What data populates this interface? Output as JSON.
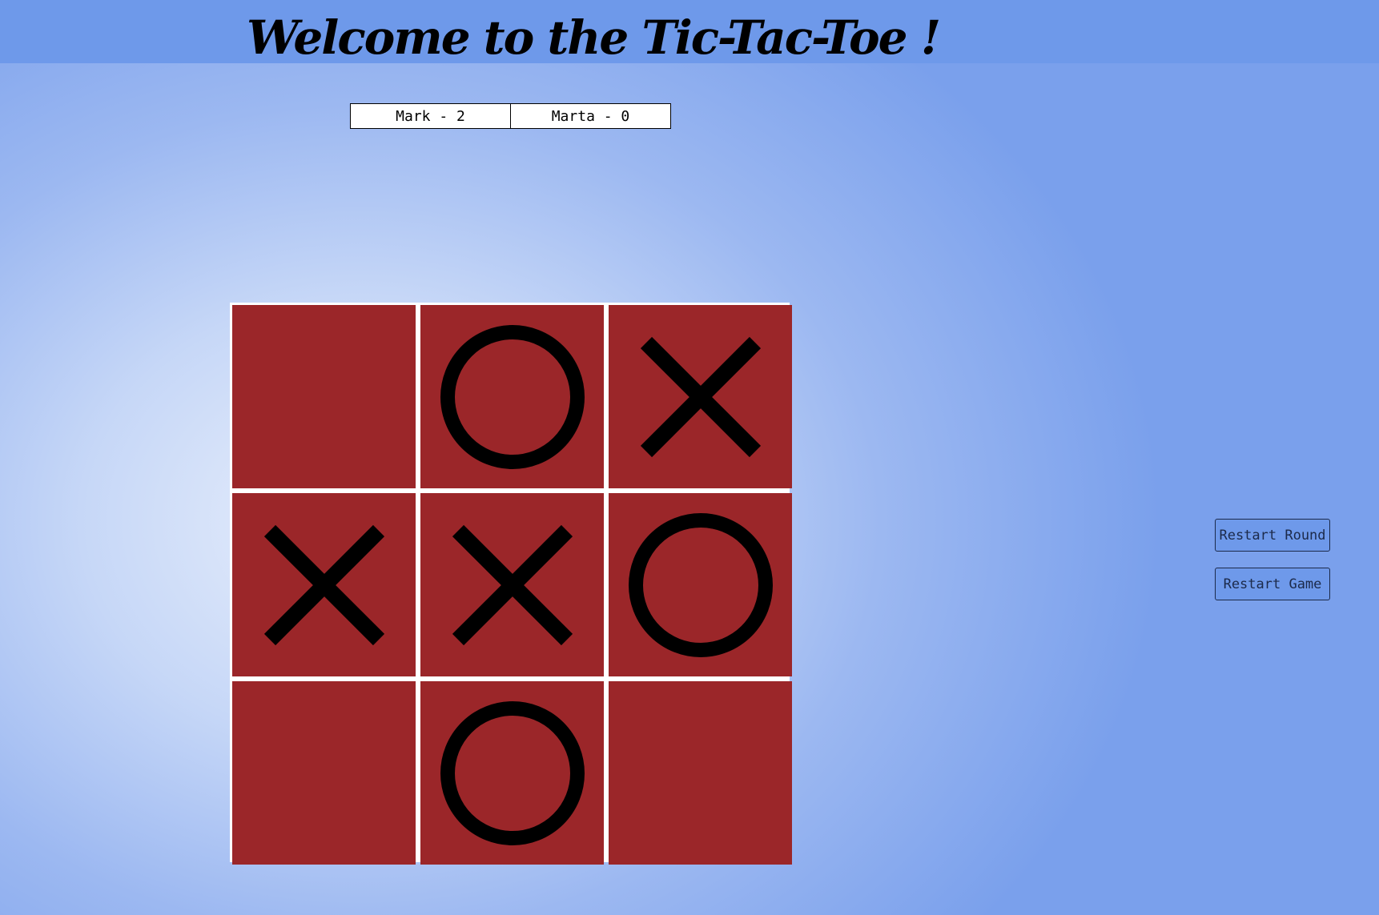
{
  "header": {
    "title": "Welcome to the Tic-Tac-Toe !"
  },
  "scoreboard": {
    "players": [
      {
        "label": "Mark - 2"
      },
      {
        "label": "Marta - 0"
      }
    ]
  },
  "board": {
    "cells": [
      "",
      "O",
      "X",
      "X",
      "X",
      "O",
      "",
      "O",
      ""
    ]
  },
  "controls": {
    "restart_round_label": "Restart Round",
    "restart_game_label": "Restart Game"
  },
  "colors": {
    "header_bg": "#6e99ea",
    "cell_bg": "#9b2629",
    "grid_lines": "#ffffff",
    "mark_color": "#000000",
    "button_bg": "#6e99ea"
  }
}
